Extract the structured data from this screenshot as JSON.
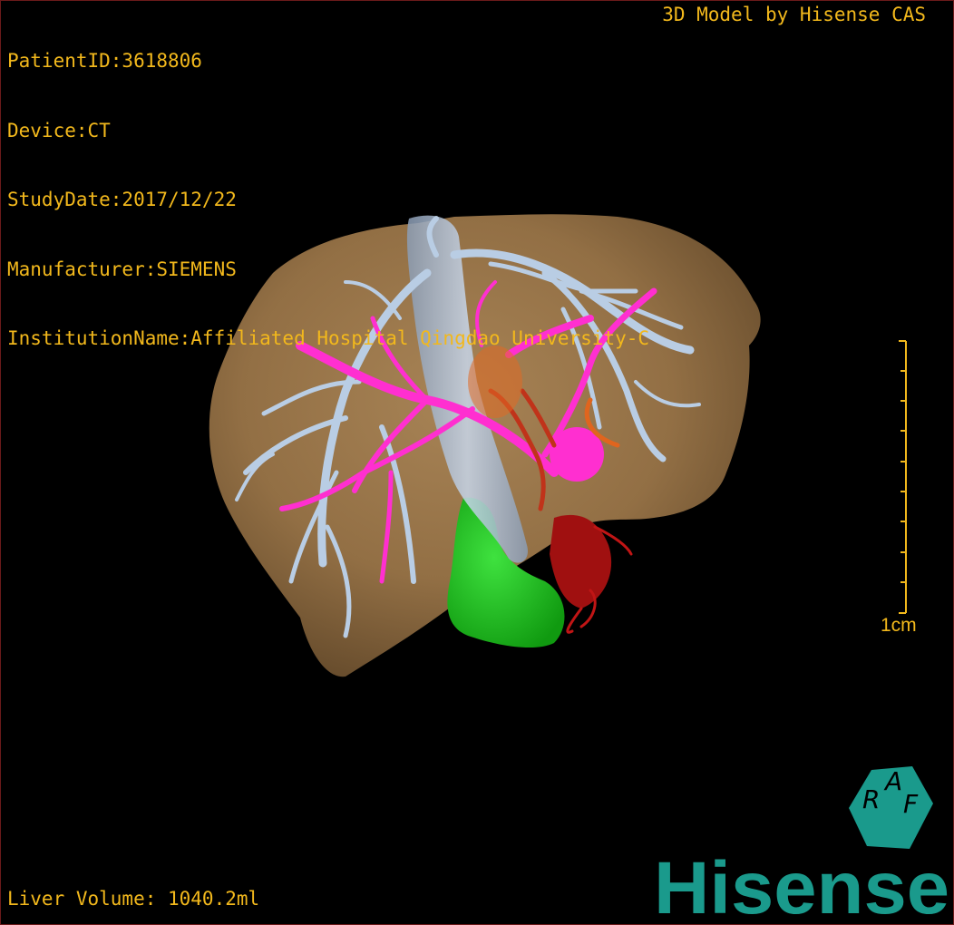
{
  "overlay": {
    "patient_id": "PatientID:3618806",
    "device": "Device:CT",
    "study_date": "StudyDate:2017/12/22",
    "manufacturer": "Manufacturer:SIEMENS",
    "institution": "InstitutionName:Affiliated Hospital Qingdao University-C"
  },
  "brand_text": "3D Model by Hisense CAS",
  "liver_volume": "Liver Volume: 1040.2ml",
  "scale": {
    "label": "1cm"
  },
  "logo": {
    "hex_letters": [
      "R",
      "A",
      "F"
    ],
    "wordmark": "Hisense"
  },
  "colors": {
    "overlay_text": "#f2b81c",
    "liver": "#9a7548",
    "hepatic_vein": "#b9cde4",
    "portal_vein": "#ff2fd0",
    "artery": "#c0331a",
    "gallbladder": "#1ec81e",
    "brand_teal": "#1a9a8c"
  }
}
